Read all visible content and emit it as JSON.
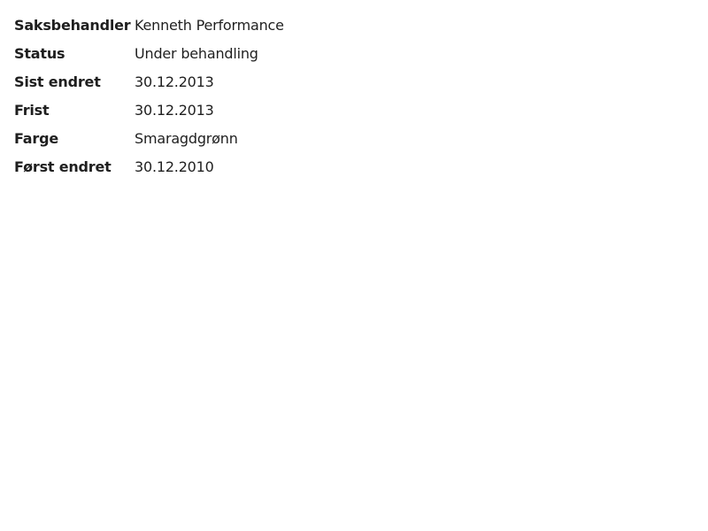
{
  "details": {
    "rows": [
      {
        "label": "Saksbehandler",
        "value": "Kenneth Performance"
      },
      {
        "label": "Status",
        "value": "Under behandling"
      },
      {
        "label": "Sist endret",
        "value": "30.12.2013"
      },
      {
        "label": "Frist",
        "value": "30.12.2013"
      },
      {
        "label": "Farge",
        "value": "Smaragdgrønn"
      },
      {
        "label": "Først endret",
        "value": "30.12.2010"
      }
    ]
  },
  "colors": {
    "text": "#1f1f1f",
    "background": "#ffffff"
  }
}
